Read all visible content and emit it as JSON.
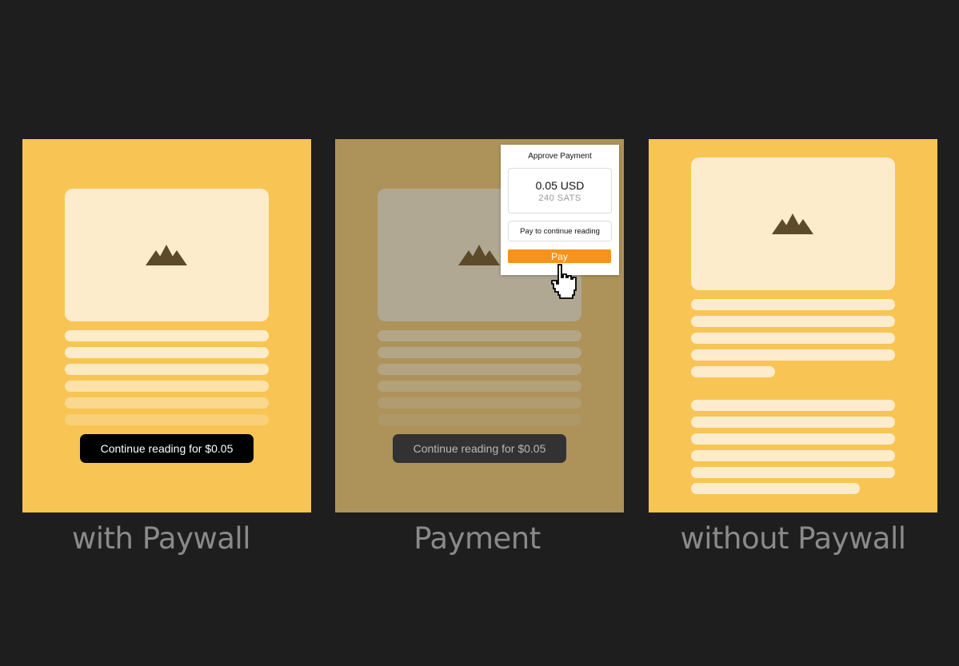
{
  "panels": [
    {
      "caption": "with Paywall",
      "button_label": "Continue reading for $0.05"
    },
    {
      "caption": "Payment",
      "button_label": "Continue reading for $0.05"
    },
    {
      "caption": "without Paywall"
    }
  ],
  "payment_popup": {
    "title": "Approve Payment",
    "amount_usd": "0.05 USD",
    "amount_sats": "240 SATS",
    "description": "Pay to continue reading",
    "pay_label": "Pay"
  },
  "colors": {
    "background": "#1e1e1e",
    "panel": "#f8c554",
    "panel_dimmed": "#ad9359",
    "card": "#fdeccc",
    "mountain": "#5c4a2a",
    "pay_button": "#f7931a"
  },
  "icons": [
    "mountain-icon",
    "hand-pointer-icon"
  ]
}
